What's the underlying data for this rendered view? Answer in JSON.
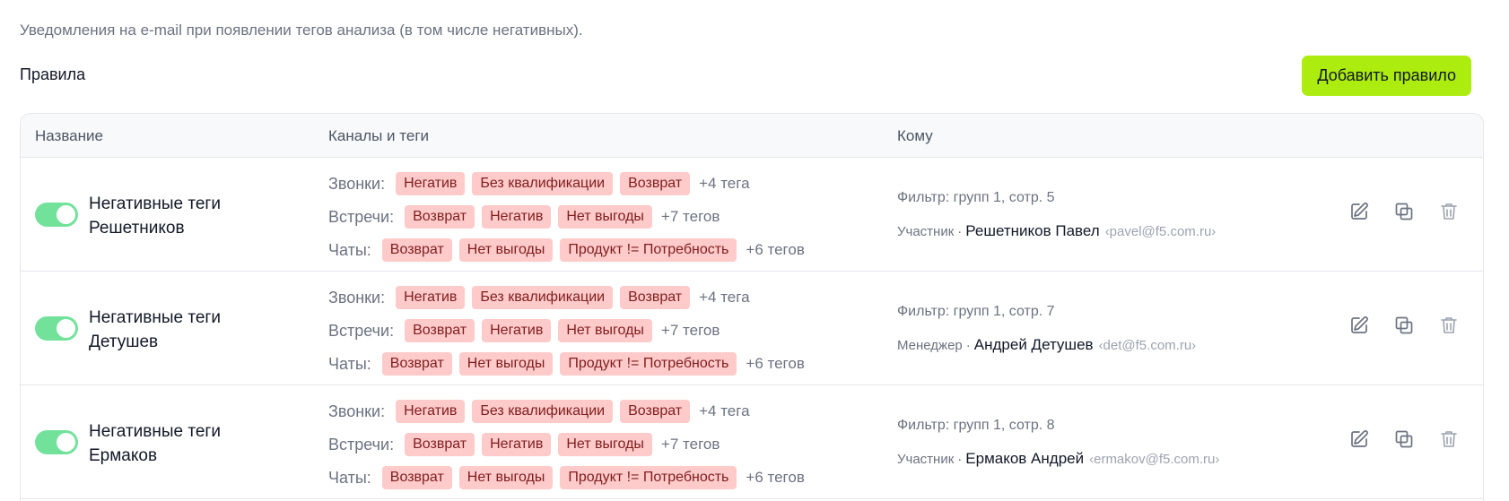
{
  "description": "Уведомления на e-mail при появлении тегов анализа (в том числе негативных).",
  "section_title": "Правила",
  "add_button_label": "Добавить правило",
  "table": {
    "columns": [
      "Название",
      "Каналы и теги",
      "Кому"
    ],
    "rows": [
      {
        "enabled": true,
        "name": "Негативные теги Решетников",
        "channels": [
          {
            "label": "Звонки:",
            "tags": [
              "Негатив",
              "Без квалификации",
              "Возврат"
            ],
            "more": "+4 тега"
          },
          {
            "label": "Встречи:",
            "tags": [
              "Возврат",
              "Негатив",
              "Нет выгоды"
            ],
            "more": "+7 тегов"
          },
          {
            "label": "Чаты:",
            "tags": [
              "Возврат",
              "Нет выгоды",
              "Продукт != Потребность"
            ],
            "more": "+6 тегов"
          }
        ],
        "filter": "Фильтр: групп 1, сотр. 5",
        "role": "Участник",
        "person": "Решетников Павел",
        "email": "‹pavel@f5.com.ru›"
      },
      {
        "enabled": true,
        "name": "Негативные теги Детушев",
        "channels": [
          {
            "label": "Звонки:",
            "tags": [
              "Негатив",
              "Без квалификации",
              "Возврат"
            ],
            "more": "+4 тега"
          },
          {
            "label": "Встречи:",
            "tags": [
              "Возврат",
              "Негатив",
              "Нет выгоды"
            ],
            "more": "+7 тегов"
          },
          {
            "label": "Чаты:",
            "tags": [
              "Возврат",
              "Нет выгоды",
              "Продукт != Потребность"
            ],
            "more": "+6 тегов"
          }
        ],
        "filter": "Фильтр: групп 1, сотр. 7",
        "role": "Менеджер",
        "person": "Андрей Детушев",
        "email": "‹det@f5.com.ru›"
      },
      {
        "enabled": true,
        "name": "Негативные теги Ермаков",
        "channels": [
          {
            "label": "Звонки:",
            "tags": [
              "Негатив",
              "Без квалификации",
              "Возврат"
            ],
            "more": "+4 тега"
          },
          {
            "label": "Встречи:",
            "tags": [
              "Возврат",
              "Негатив",
              "Нет выгоды"
            ],
            "more": "+7 тегов"
          },
          {
            "label": "Чаты:",
            "tags": [
              "Возврат",
              "Нет выгоды",
              "Продукт != Потребность"
            ],
            "more": "+6 тегов"
          }
        ],
        "filter": "Фильтр: групп 1, сотр. 8",
        "role": "Участник",
        "person": "Ермаков Андрей",
        "email": "‹ermakov@f5.com.ru›"
      }
    ]
  },
  "icons": {
    "edit": "pencil-icon",
    "duplicate": "copy-icon",
    "delete": "trash-icon"
  },
  "colors": {
    "accent": "#acec0f",
    "toggle_on": "#72e29b",
    "tag_bg": "#fecaca",
    "tag_text": "#7f1d1d"
  }
}
